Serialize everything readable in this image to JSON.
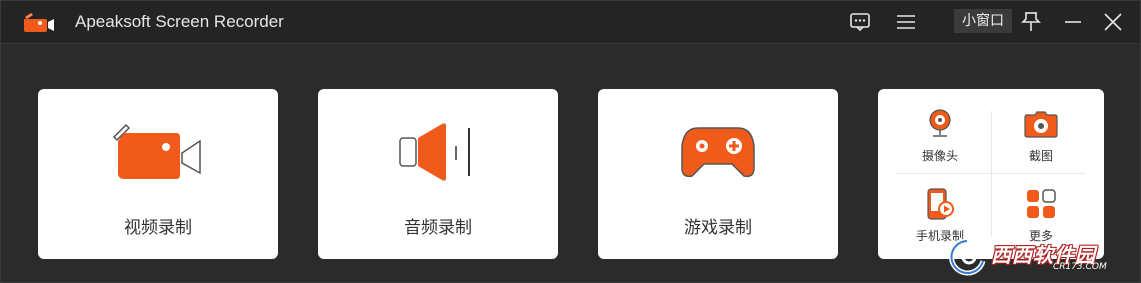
{
  "window": {
    "title": "Apeaksoft Screen Recorder",
    "mini_window_label": "小窗口",
    "icons": {
      "logo": "camera-logo-icon",
      "feedback": "chat-icon",
      "menu": "menu-icon",
      "pin": "pin-icon",
      "minimize": "minimize-icon",
      "close": "close-icon"
    }
  },
  "cards": [
    {
      "label": "视频录制",
      "icon": "video-camera-icon"
    },
    {
      "label": "音频录制",
      "icon": "speaker-icon"
    },
    {
      "label": "游戏录制",
      "icon": "gamepad-icon"
    }
  ],
  "tools": [
    {
      "label": "摄像头",
      "icon": "webcam-icon"
    },
    {
      "label": "截图",
      "icon": "camera-icon"
    },
    {
      "label": "手机录制",
      "icon": "phone-record-icon"
    },
    {
      "label": "更多",
      "icon": "grid-icon"
    }
  ],
  "watermark": {
    "text": "西西软件园",
    "sub": "CR173.COM"
  },
  "colors": {
    "accent": "#f05a1a",
    "background": "#2b2b2b",
    "titlebar": "#242424",
    "card": "#ffffff"
  }
}
